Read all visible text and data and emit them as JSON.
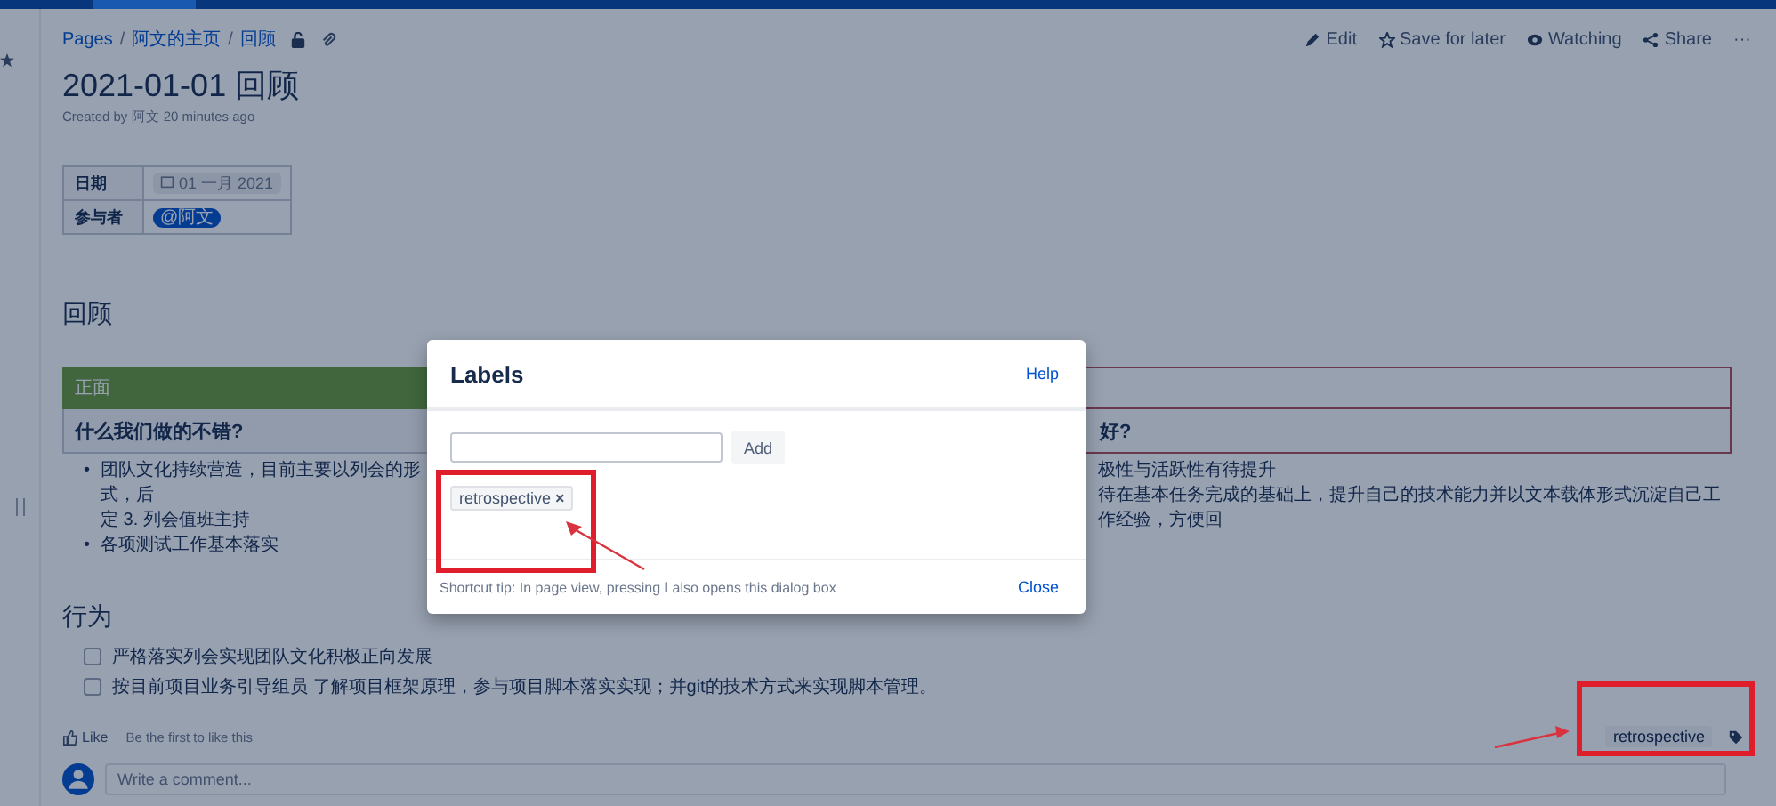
{
  "breadcrumbs": [
    {
      "label": "Pages"
    },
    {
      "separator": "/",
      "label": "阿文的主页"
    },
    {
      "separator": "/",
      "label": "回顾"
    }
  ],
  "page_actions": [
    {
      "kind": "edit",
      "label": "Edit"
    },
    {
      "kind": "save",
      "label": "Save for later"
    },
    {
      "kind": "watch",
      "label": "Watching"
    },
    {
      "kind": "share",
      "label": "Share"
    },
    {
      "kind": "more",
      "label": "···"
    }
  ],
  "page": {
    "title": "2021-01-01 回顾",
    "byline": "Created by 阿文 20 minutes ago"
  },
  "info_table": [
    {
      "label": "日期",
      "kind": "date",
      "value": "01 一月 2021"
    },
    {
      "label": "参与者",
      "kind": "mention",
      "value": "@阿文"
    }
  ],
  "retro": {
    "heading": "回顾",
    "columns": [
      {
        "tag": "正面",
        "kind": "positive",
        "question": "什么我们做的不错?",
        "items": [
          {
            "marker": "•",
            "lines": [
              "团队文化持续营造，目前主要以列会的形式，后",
              "定  3. 列会值班主持"
            ]
          },
          {
            "marker": "•",
            "lines": [
              "各项测试工作基本落实"
            ]
          }
        ]
      },
      {
        "kind": "negative",
        "question": "好?",
        "items": [
          {
            "lines": [
              "极性与活跃性有待提升"
            ]
          },
          {
            "lines": [
              "待在基本任务完成的基础上，提升自己的技术能力并以文本载体形式沉淀自己工作经验，方便回"
            ]
          }
        ]
      }
    ]
  },
  "actions_section": {
    "heading": "行为",
    "tasks": [
      {
        "text": "严格落实列会实现团队文化积极正向发展",
        "checked": false
      },
      {
        "text": "按目前项目业务引导组员 了解项目框架原理，参与项目脚本落实实现；并git的技术方式来实现脚本管理。",
        "checked": false
      }
    ]
  },
  "like": {
    "label": "Like",
    "note": "Be the first to like this"
  },
  "labels": [
    {
      "text": "retrospective"
    }
  ],
  "comment": {
    "placeholder": "Write a comment..."
  },
  "dialog": {
    "title": "Labels",
    "help": "Help",
    "add_button": "Add",
    "chips": [
      {
        "text": "retrospective",
        "remove": "×"
      }
    ],
    "tip": "Shortcut tip: In page view, pressing **l** also opens this dialog box",
    "close": "Close"
  }
}
